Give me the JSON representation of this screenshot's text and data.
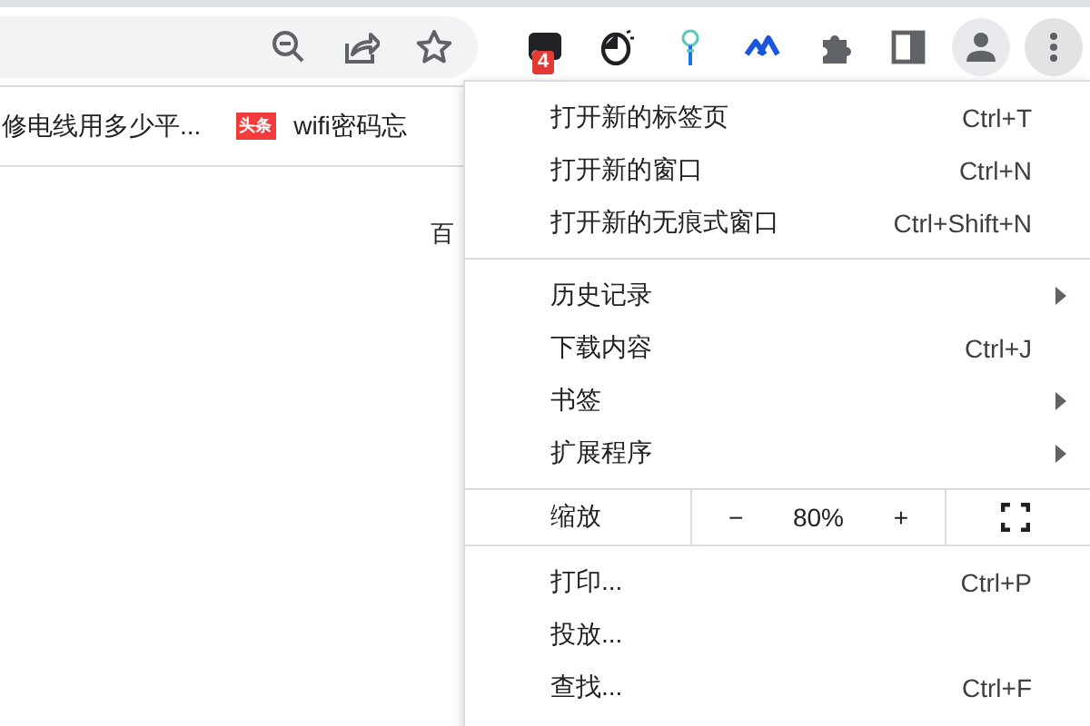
{
  "toolbar": {
    "address_icons": [
      {
        "kind": "zoom"
      },
      {
        "kind": "share"
      },
      {
        "kind": "star"
      }
    ],
    "extensions": [
      {
        "kind": "note",
        "badge": "4"
      },
      {
        "kind": "mouse"
      },
      {
        "kind": "pin"
      },
      {
        "kind": "peaks"
      },
      {
        "kind": "puzzle"
      },
      {
        "kind": "panel"
      },
      {
        "kind": "avatar"
      },
      {
        "kind": "menu"
      }
    ]
  },
  "bookmarks": [
    {
      "kind": "text",
      "label": "修电线用多少平..."
    },
    {
      "kind": "tagged",
      "tag": "头条",
      "label": "wifi密码忘"
    }
  ],
  "page": {
    "text": "百"
  },
  "menu": {
    "sections": [
      [
        {
          "label": "打开新的标签页",
          "shortcut": "Ctrl+T",
          "submenu": false
        },
        {
          "label": "打开新的窗口",
          "shortcut": "Ctrl+N",
          "submenu": false
        },
        {
          "label": "打开新的无痕式窗口",
          "shortcut": "Ctrl+Shift+N",
          "submenu": false
        }
      ],
      [
        {
          "label": "历史记录",
          "submenu": true
        },
        {
          "label": "下载内容",
          "shortcut": "Ctrl+J",
          "submenu": false
        },
        {
          "label": "书签",
          "submenu": true
        },
        {
          "label": "扩展程序",
          "submenu": true
        }
      ],
      [
        {
          "kind": "zoom",
          "label": "缩放",
          "minus": "−",
          "value": "80%",
          "plus": "+"
        }
      ],
      [
        {
          "label": "打印...",
          "shortcut": "Ctrl+P",
          "submenu": false
        },
        {
          "label": "投放...",
          "submenu": false
        },
        {
          "label": "查找...",
          "shortcut": "Ctrl+F",
          "submenu": false
        }
      ]
    ]
  }
}
